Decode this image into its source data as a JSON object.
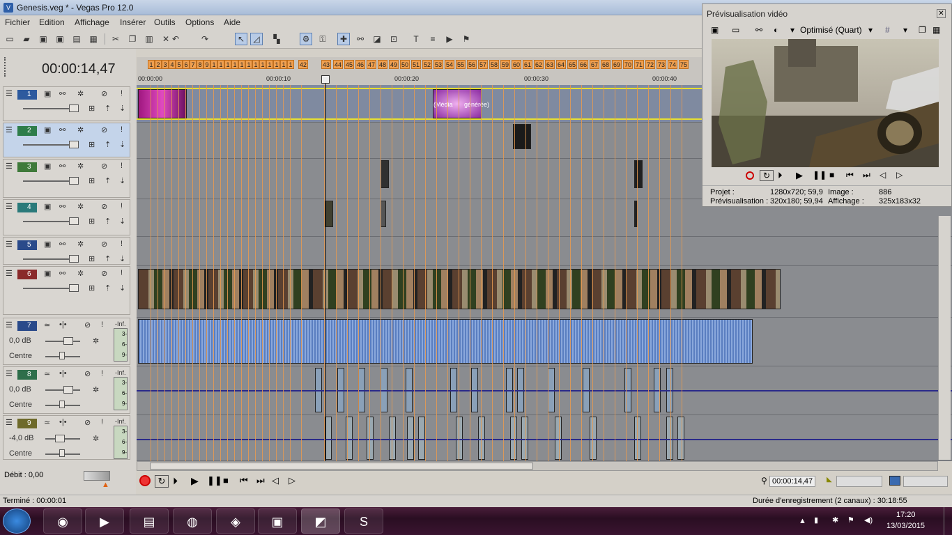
{
  "window": {
    "title": "Genesis.veg * - Vegas Pro 12.0"
  },
  "menu": [
    "Fichier",
    "Edition",
    "Affichage",
    "Insérer",
    "Outils",
    "Options",
    "Aide"
  ],
  "cursor_time": "00:00:14,47",
  "tracks": [
    {
      "num": "1",
      "kind": "video",
      "color": "#2d5a9e"
    },
    {
      "num": "2",
      "kind": "video",
      "color": "#2e7d4a"
    },
    {
      "num": "3",
      "kind": "video",
      "color": "#3f7a3a"
    },
    {
      "num": "4",
      "kind": "video",
      "color": "#2a7a7a"
    },
    {
      "num": "5",
      "kind": "video",
      "color": "#2a4a8a"
    },
    {
      "num": "6",
      "kind": "video",
      "color": "#8a2a2a"
    },
    {
      "num": "7",
      "kind": "audio",
      "color": "#2a4a8a",
      "db": "0,0 dB",
      "pan": "Centre",
      "meter": "-Inf.",
      "meter_ticks": [
        "3-",
        "6-",
        "9-"
      ]
    },
    {
      "num": "8",
      "kind": "audio",
      "color": "#2e6e4a",
      "db": "0,0 dB",
      "pan": "Centre",
      "meter": "-Inf.",
      "meter_ticks": [
        "3-",
        "6-",
        "9-"
      ]
    },
    {
      "num": "9",
      "kind": "audio",
      "color": "#6e6a2a",
      "db": "-4,0 dB",
      "pan": "Centre",
      "meter": "-Inf.",
      "meter_ticks": [
        "3-",
        "6-",
        "9-"
      ]
    }
  ],
  "ruler": {
    "markers_dense": [
      "1",
      "2",
      "3",
      "4",
      "5",
      "6",
      "7",
      "8",
      "9",
      "1",
      "1",
      "1",
      "1",
      "1",
      "1",
      "1",
      "1",
      "1",
      "1",
      "1",
      "1"
    ],
    "markers": [
      "42",
      "43",
      "44",
      "45",
      "46",
      "47",
      "48",
      "49",
      "50",
      "51",
      "52",
      "53",
      "54",
      "55",
      "56",
      "57",
      "58",
      "59",
      "60",
      "61",
      "62",
      "63",
      "64",
      "65",
      "66",
      "67",
      "68",
      "69",
      "70",
      "71",
      "72",
      "73",
      "74",
      "75"
    ],
    "times": [
      "00:00:00",
      "00:00:10",
      "00:00:20",
      "00:00:30",
      "00:00:40"
    ]
  },
  "clip_labels": {
    "media": "(Média",
    "generated": "générée)"
  },
  "preview": {
    "title": "Prévisualisation vidéo",
    "quality": "Optimisé (Quart)",
    "projet_label": "Projet :",
    "projet_value": "1280x720; 59,9",
    "image_label": "Image :",
    "image_value": "886",
    "previs_label": "Prévisualisation :",
    "previs_value": "320x180; 59,94",
    "affichage_label": "Affichage :",
    "affichage_value": "325x183x32"
  },
  "debit": "Débit : 0,00",
  "transport_time": "00:00:14,47",
  "status": {
    "left": "Terminé : 00:00:01",
    "right": "Durée d'enregistrement (2 canaux) : 30:18:55"
  },
  "clock": {
    "time": "17:20",
    "date": "13/03/2015"
  },
  "taskbar_apps": [
    "start",
    "chrome",
    "media-player",
    "explorer",
    "winamp",
    "game",
    "vegas-player",
    "vegas",
    "skype"
  ]
}
